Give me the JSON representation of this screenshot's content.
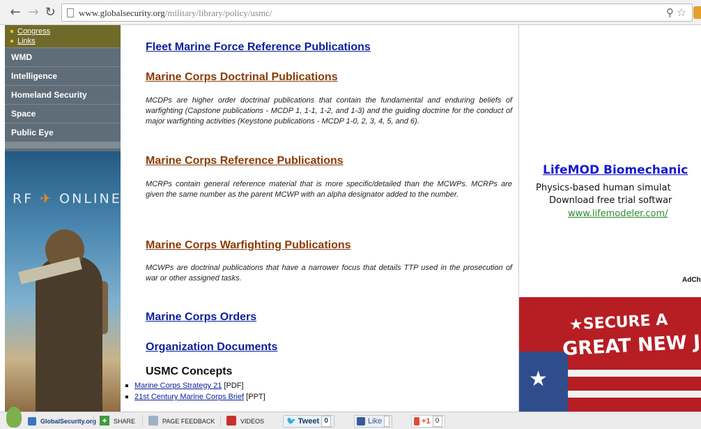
{
  "browser": {
    "url_host": "www.globalsecurity.org",
    "url_path": "/military/library/policy/usmc/"
  },
  "sidebar": {
    "sub_items": [
      {
        "label": "Congress"
      },
      {
        "label": "Links"
      }
    ],
    "items": [
      {
        "label": "WMD"
      },
      {
        "label": "Intelligence"
      },
      {
        "label": "Homeland Security"
      },
      {
        "label": "Space"
      },
      {
        "label": "Public Eye"
      }
    ],
    "ad": {
      "logo_pre": "RF",
      "logo_mark": "✈",
      "logo_post": "ONLINE"
    }
  },
  "main": {
    "fmfrp": "Fleet Marine Force Reference Publications",
    "mcdp_title": "Marine Corps Doctrinal Publications",
    "mcdp_desc": "MCDPs are higher order doctrinal publications that contain the fundamental and enduring beliefs of warfighting (Capstone publications - MCDP 1, 1-1, 1-2, and 1-3) and the guiding doctrine for the conduct of major warfighting activities (Keystone publications - MCDP 1-0, 2, 3, 4, 5, and 6).",
    "mcrp_title": "Marine Corps Reference Publications",
    "mcrp_desc": "MCRPs contain general reference material that is more specific/detailed than the MCWPs. MCRPs are given the same number as the parent MCWP with an alpha designator added to the number.",
    "mcwp_title": "Marine Corps Warfighting Publications",
    "mcwp_desc": "MCWPs are doctrinal publications that have a narrower focus that details TTP used in the prosecution of war or other assigned tasks.",
    "orders": "Marine Corps Orders",
    "org_docs": "Organization Documents",
    "concepts_title": "USMC Concepts",
    "concepts": [
      {
        "link": "Marine Corps Strategy 21",
        "suffix": " [PDF]"
      },
      {
        "link": "21st Century Marine Corps Brief",
        "suffix": " [PPT]"
      }
    ]
  },
  "right_ad": {
    "title": "LifeMOD Biomechanic",
    "line1": "Physics-based human simulat",
    "line2": "Download free trial softwar",
    "url": "www.lifemodeler.com/",
    "adchoices": "AdCh",
    "banner_line1": "★SECURE A",
    "banner_line2": "GREAT NEW J"
  },
  "bottombar": {
    "logo": "GlobalSecurity.org",
    "share": "SHARE",
    "feedback": "PAGE FEEDBACK",
    "videos": "VIDEOS",
    "tweet": "Tweet",
    "tweet_count": "0",
    "like": "Like",
    "gplus": "+1",
    "gplus_count": "0"
  },
  "colors": {
    "link_blue": "#0a1f9a",
    "heading_brown": "#8a3b05",
    "sidebar_bg": "#5f6d79",
    "ad_green": "#2c8a2c"
  }
}
